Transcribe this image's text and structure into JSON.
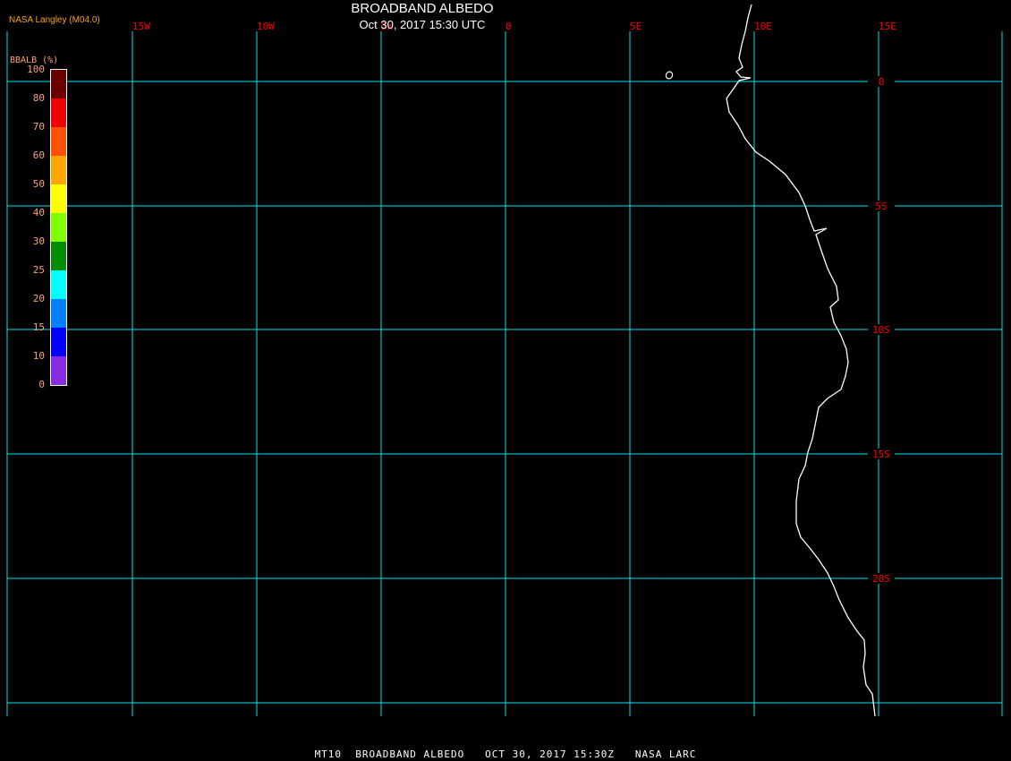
{
  "header": {
    "title": "BROADBAND ALBEDO",
    "subtitle": "Oct 30, 2017 15:30 UTC",
    "credit": "NASA Langley (M04.0)"
  },
  "footer": "MT10  BROADBAND ALBEDO   OCT 30, 2017 15:30Z   NASA LARC",
  "map": {
    "gridline_color": "#00e5ee",
    "label_color": "#ff0000",
    "coast_color": "#ffffff",
    "lon_labels": [
      "15W",
      "10W",
      "5W",
      "0",
      "5E",
      "10E",
      "15E"
    ],
    "lat_labels": [
      "0",
      "5S",
      "10S",
      "15S",
      "20S"
    ]
  },
  "colorbar": {
    "title": "BBALB (%)",
    "labels": [
      "100",
      "80",
      "70",
      "60",
      "50",
      "40",
      "30",
      "25",
      "20",
      "15",
      "10",
      "0"
    ],
    "colors": [
      "#6a0000",
      "#f00000",
      "#ff5000",
      "#ffa500",
      "#ffff00",
      "#80ff00",
      "#008c00",
      "#00ffff",
      "#0080ff",
      "#0000ff",
      "#8a2be2"
    ]
  }
}
